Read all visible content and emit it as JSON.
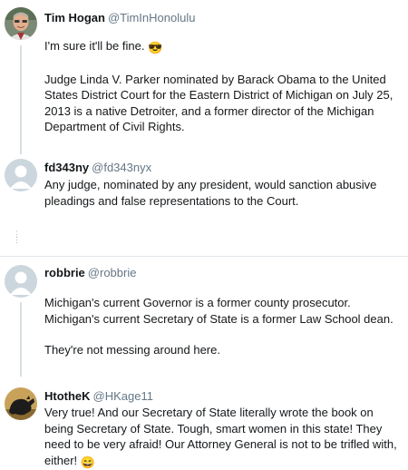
{
  "tweets": [
    {
      "name": "Tim Hogan",
      "handle": "@TimInHonolulu",
      "text_1": "I'm sure it'll be fine.",
      "emoji_1": "😎",
      "text_2": "Judge Linda V. Parker nominated by Barack Obama to the United States District Court for the Eastern District of Michigan on July 25, 2013 is a native Detroiter, and a former director of the Michigan Department of Civil Rights."
    },
    {
      "name": "fd343ny",
      "handle": "@fd343nyx",
      "text_1": "Any judge, nominated by any president, would sanction abusive pleadings and false representations to the Court."
    },
    {
      "name": "robbrie",
      "handle": "@robbrie",
      "text_1": "Michigan's current Governor is a former county prosecutor. Michigan's current Secretary of State is a former Law School dean.",
      "text_2": "They're not messing around here."
    },
    {
      "name": "HtotheK",
      "handle": "@HKage11",
      "text_1": "Very true! And our Secretary of State literally wrote the book on being Secretary of State. Tough, smart women in this state! They need to be very afraid!  Our Attorney General is not to be trifled with, either!",
      "emoji_1": "😄"
    }
  ],
  "icons": {
    "default_avatar": "default-profile-icon",
    "tim_avatar": "tim-hogan-photo",
    "htothek_avatar": "horse-photo"
  },
  "colors": {
    "handle": "#657786",
    "thread_line": "#d6dee3",
    "divider": "#e1e8ed",
    "default_avatar_bg": "#ccd6dd"
  }
}
